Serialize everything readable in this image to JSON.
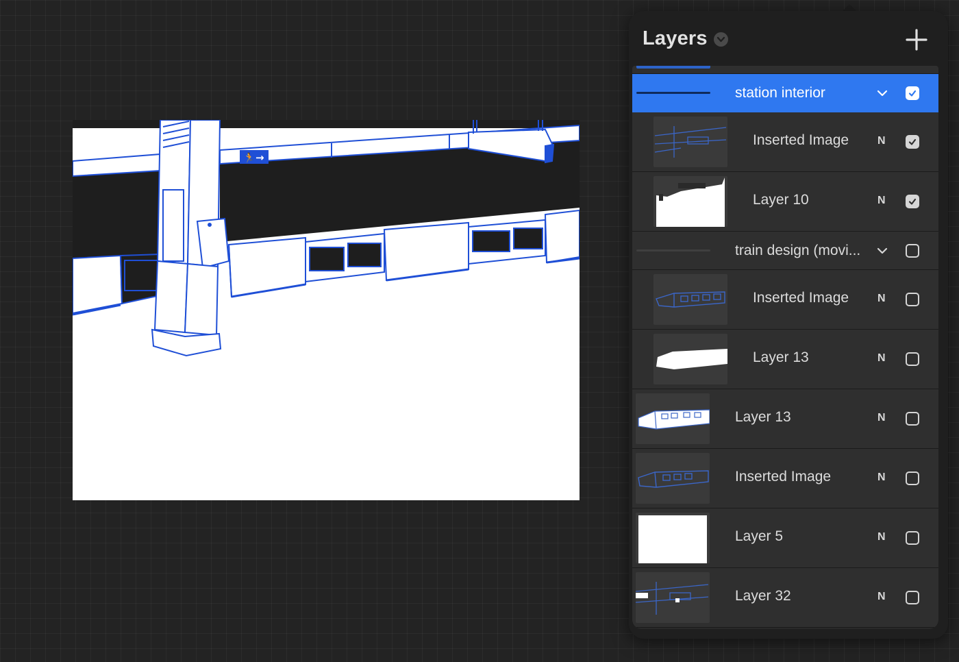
{
  "panel": {
    "title": "Layers",
    "add_icon": "plus-icon",
    "title_icon": "chevron-down-icon"
  },
  "canvas": {
    "exit_sign_icon": "running-man-exit-icon",
    "exit_arrow_icon": "arrow-right-icon",
    "line_color": "#1f4fd6"
  },
  "layers": [
    {
      "name": "station interior",
      "type": "group",
      "selected": true,
      "visible": true,
      "thumbnail": "group-line"
    },
    {
      "name": "Inserted Image",
      "blend": "N",
      "visible": true,
      "indent": true,
      "thumbnail": "station-sketch"
    },
    {
      "name": "Layer 10",
      "blend": "N",
      "visible": true,
      "indent": true,
      "thumbnail": "white-mask"
    },
    {
      "name": "train design (movi...",
      "type": "group",
      "selected": false,
      "visible": false,
      "thumbnail": "group-line"
    },
    {
      "name": "Inserted Image",
      "blend": "N",
      "visible": false,
      "indent": true,
      "thumbnail": "train-sketch"
    },
    {
      "name": "Layer 13",
      "blend": "N",
      "visible": false,
      "indent": true,
      "thumbnail": "train-silhouette"
    },
    {
      "name": "Layer 13",
      "blend": "N",
      "visible": false,
      "indent": false,
      "thumbnail": "train-lineart"
    },
    {
      "name": "Inserted Image",
      "blend": "N",
      "visible": false,
      "indent": false,
      "thumbnail": "train-sketch-blue"
    },
    {
      "name": "Layer 5",
      "blend": "N",
      "visible": false,
      "indent": false,
      "thumbnail": "white-fill"
    },
    {
      "name": "Layer 32",
      "blend": "N",
      "visible": false,
      "indent": false,
      "thumbnail": "station-sketch-partial"
    }
  ],
  "colors": {
    "selected_row": "#2f78f0",
    "panel_bg": "#1f1f1f",
    "row_bg": "#2f2f2f",
    "canvas_bg": "#232323"
  }
}
